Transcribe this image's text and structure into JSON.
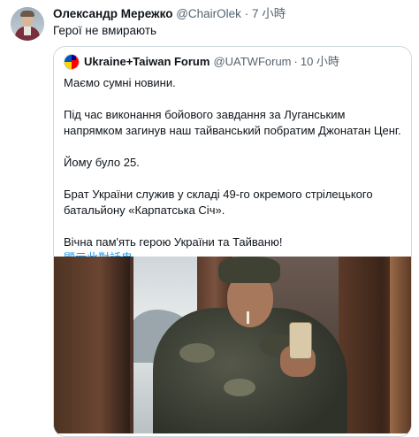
{
  "tweet": {
    "author_name": "Олександр Мережко",
    "author_handle": "@ChairOlek",
    "separator": "·",
    "time": "7 小時",
    "text": "Герої не вмирають"
  },
  "quoted": {
    "author_name": "Ukraine+Taiwan Forum",
    "author_handle": "@UATWForum",
    "separator": "·",
    "time": "10 小時",
    "paragraphs": [
      "Маємо сумні новини.",
      "Під час виконання бойового завдання за Луганським напрямком загинув наш тайванський побратим Джонатан Ценг.",
      "Йому було 25.",
      "Брат України служив у складі 49-го окремого стрілецького батальйону «Карпатська Січ».",
      "Вічна пам'ять герою України та Тайваню!"
    ],
    "show_thread": "顯示此對話串"
  },
  "colors": {
    "text": "#0f1419",
    "muted": "#536471",
    "link": "#1d9bf0",
    "border": "#cfd9de"
  }
}
